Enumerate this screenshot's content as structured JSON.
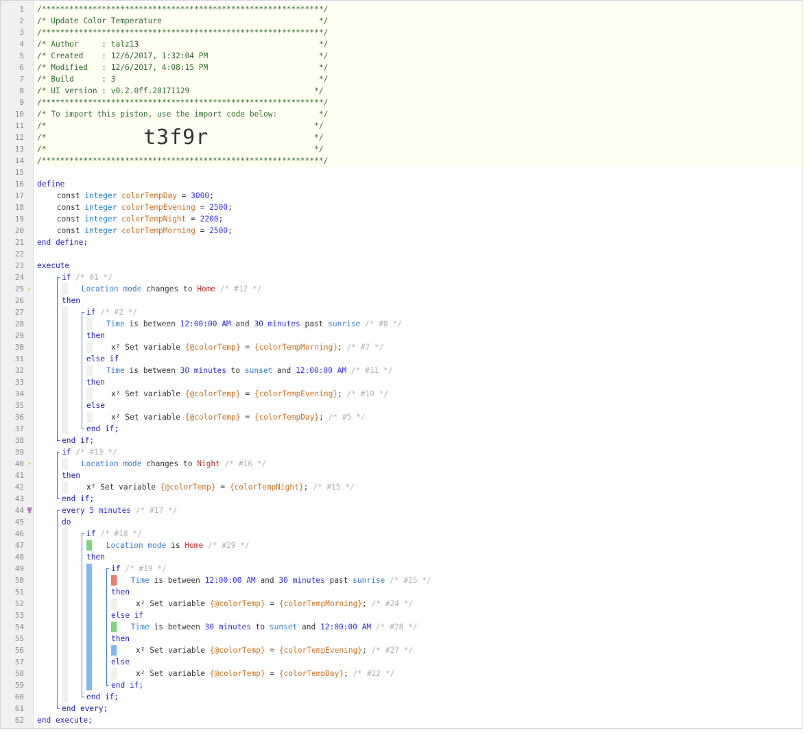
{
  "editor": {
    "lines": [
      {
        "n": "1",
        "tokens": [
          {
            "t": "/*************************************************************/",
            "c": "comment"
          }
        ]
      },
      {
        "n": "2",
        "tokens": [
          {
            "t": "/* Update Color Temperature                                  */",
            "c": "comment"
          }
        ]
      },
      {
        "n": "3",
        "tokens": [
          {
            "t": "/*************************************************************/",
            "c": "comment"
          }
        ]
      },
      {
        "n": "4",
        "tokens": [
          {
            "t": "/* Author     : talz13                                       */",
            "c": "comment"
          }
        ]
      },
      {
        "n": "5",
        "tokens": [
          {
            "t": "/* Created    : 12/6/2017, 1:32:04 PM                        */",
            "c": "comment"
          }
        ]
      },
      {
        "n": "6",
        "tokens": [
          {
            "t": "/* Modified   : 12/6/2017, 4:08:15 PM                        */",
            "c": "comment"
          }
        ]
      },
      {
        "n": "7",
        "tokens": [
          {
            "t": "/* Build      : 3                                            */",
            "c": "comment"
          }
        ]
      },
      {
        "n": "8",
        "tokens": [
          {
            "t": "/* UI version : v0.2.0ff.20171129                           */",
            "c": "comment"
          }
        ]
      },
      {
        "n": "9",
        "tokens": [
          {
            "t": "/*************************************************************/",
            "c": "comment"
          }
        ]
      },
      {
        "n": "10",
        "tokens": [
          {
            "t": "/* To import this piston, use the import code below:         */",
            "c": "comment"
          }
        ]
      },
      {
        "n": "11",
        "tokens": [
          {
            "t": "/*                                                          */",
            "c": "comment"
          }
        ]
      },
      {
        "n": "12",
        "tokens": [
          {
            "t": "/*                                                          */",
            "c": "comment"
          }
        ],
        "bigcode": "t3f9r"
      },
      {
        "n": "13",
        "tokens": [
          {
            "t": "/*                                                          */",
            "c": "comment"
          }
        ]
      },
      {
        "n": "14",
        "tokens": [
          {
            "t": "/*************************************************************/",
            "c": "comment"
          }
        ]
      },
      {
        "n": "15",
        "tokens": []
      },
      {
        "n": "16",
        "tokens": [
          {
            "t": "define",
            "c": "kw"
          }
        ]
      },
      {
        "n": "17",
        "indent": 4,
        "tokens": [
          {
            "t": "const ",
            "c": "plain"
          },
          {
            "t": "integer ",
            "c": "type"
          },
          {
            "t": "colorTempDay",
            "c": "var"
          },
          {
            "t": " = ",
            "c": "op"
          },
          {
            "t": "3000",
            "c": "num"
          },
          {
            "t": ";",
            "c": "op"
          }
        ]
      },
      {
        "n": "18",
        "indent": 4,
        "tokens": [
          {
            "t": "const ",
            "c": "plain"
          },
          {
            "t": "integer ",
            "c": "type"
          },
          {
            "t": "colorTempEvening",
            "c": "var"
          },
          {
            "t": " = ",
            "c": "op"
          },
          {
            "t": "2500",
            "c": "num"
          },
          {
            "t": ";",
            "c": "op"
          }
        ]
      },
      {
        "n": "19",
        "indent": 4,
        "tokens": [
          {
            "t": "const ",
            "c": "plain"
          },
          {
            "t": "integer ",
            "c": "type"
          },
          {
            "t": "colorTempNight",
            "c": "var"
          },
          {
            "t": " = ",
            "c": "op"
          },
          {
            "t": "2200",
            "c": "num"
          },
          {
            "t": ";",
            "c": "op"
          }
        ]
      },
      {
        "n": "20",
        "indent": 4,
        "tokens": [
          {
            "t": "const ",
            "c": "plain"
          },
          {
            "t": "integer ",
            "c": "type"
          },
          {
            "t": "colorTempMorning",
            "c": "var"
          },
          {
            "t": " = ",
            "c": "op"
          },
          {
            "t": "2500",
            "c": "num"
          },
          {
            "t": ";",
            "c": "op"
          }
        ]
      },
      {
        "n": "21",
        "tokens": [
          {
            "t": "end define;",
            "c": "kw"
          }
        ]
      },
      {
        "n": "22",
        "tokens": []
      },
      {
        "n": "23",
        "tokens": [
          {
            "t": "execute",
            "c": "kw"
          }
        ]
      },
      {
        "n": "24",
        "indent": 5,
        "tokens": [
          {
            "t": "if ",
            "c": "kw"
          },
          {
            "t": "/* #1 */",
            "c": "gray"
          }
        ]
      },
      {
        "n": "25",
        "marker": "flash",
        "indent": 9,
        "tokens": [
          {
            "t": "Location mode ",
            "c": "attr"
          },
          {
            "t": "changes to ",
            "c": "plain"
          },
          {
            "t": "Home",
            "c": "str"
          },
          {
            "t": " /* #12 */",
            "c": "gray"
          }
        ]
      },
      {
        "n": "26",
        "indent": 5,
        "tokens": [
          {
            "t": "then",
            "c": "kw"
          }
        ]
      },
      {
        "n": "27",
        "indent": 10,
        "tokens": [
          {
            "t": "if ",
            "c": "kw"
          },
          {
            "t": "/* #2 */",
            "c": "gray"
          }
        ]
      },
      {
        "n": "28",
        "indent": 14,
        "tokens": [
          {
            "t": "Time ",
            "c": "attr"
          },
          {
            "t": "is between ",
            "c": "plain"
          },
          {
            "t": "12:00:00 AM",
            "c": "num"
          },
          {
            "t": " and ",
            "c": "plain"
          },
          {
            "t": "30 minutes",
            "c": "num"
          },
          {
            "t": " past ",
            "c": "plain"
          },
          {
            "t": "sunrise",
            "c": "attr"
          },
          {
            "t": " /* #8 */",
            "c": "gray"
          }
        ]
      },
      {
        "n": "29",
        "indent": 10,
        "tokens": [
          {
            "t": "then",
            "c": "kw"
          }
        ]
      },
      {
        "n": "30",
        "indent": 15,
        "tokens": [
          {
            "t": "x² ",
            "c": "x2"
          },
          {
            "t": "Set variable ",
            "c": "plain"
          },
          {
            "t": "{@colorTemp}",
            "c": "var"
          },
          {
            "t": " = ",
            "c": "op"
          },
          {
            "t": "{colorTempMorning}",
            "c": "var"
          },
          {
            "t": ";",
            "c": "op"
          },
          {
            "t": " /* #7 */",
            "c": "gray"
          }
        ]
      },
      {
        "n": "31",
        "indent": 10,
        "tokens": [
          {
            "t": "else if",
            "c": "kw"
          }
        ]
      },
      {
        "n": "32",
        "indent": 14,
        "tokens": [
          {
            "t": "Time ",
            "c": "attr"
          },
          {
            "t": "is between ",
            "c": "plain"
          },
          {
            "t": "30 minutes",
            "c": "num"
          },
          {
            "t": " to ",
            "c": "plain"
          },
          {
            "t": "sunset",
            "c": "attr"
          },
          {
            "t": " and ",
            "c": "plain"
          },
          {
            "t": "12:00:00 AM",
            "c": "num"
          },
          {
            "t": " /* #11 */",
            "c": "gray"
          }
        ]
      },
      {
        "n": "33",
        "indent": 10,
        "tokens": [
          {
            "t": "then",
            "c": "kw"
          }
        ]
      },
      {
        "n": "34",
        "indent": 15,
        "tokens": [
          {
            "t": "x² ",
            "c": "x2"
          },
          {
            "t": "Set variable ",
            "c": "plain"
          },
          {
            "t": "{@colorTemp}",
            "c": "var"
          },
          {
            "t": " = ",
            "c": "op"
          },
          {
            "t": "{colorTempEvening}",
            "c": "var"
          },
          {
            "t": ";",
            "c": "op"
          },
          {
            "t": " /* #10 */",
            "c": "gray"
          }
        ]
      },
      {
        "n": "35",
        "indent": 10,
        "tokens": [
          {
            "t": "else",
            "c": "kw"
          }
        ]
      },
      {
        "n": "36",
        "indent": 15,
        "tokens": [
          {
            "t": "x² ",
            "c": "x2"
          },
          {
            "t": "Set variable ",
            "c": "plain"
          },
          {
            "t": "{@colorTemp}",
            "c": "var"
          },
          {
            "t": " = ",
            "c": "op"
          },
          {
            "t": "{colorTempDay}",
            "c": "var"
          },
          {
            "t": ";",
            "c": "op"
          },
          {
            "t": " /* #5 */",
            "c": "gray"
          }
        ]
      },
      {
        "n": "37",
        "indent": 10,
        "tokens": [
          {
            "t": "end if;",
            "c": "kw"
          }
        ]
      },
      {
        "n": "38",
        "indent": 5,
        "tokens": [
          {
            "t": "end if;",
            "c": "kw"
          }
        ]
      },
      {
        "n": "39",
        "indent": 5,
        "tokens": [
          {
            "t": "if ",
            "c": "kw"
          },
          {
            "t": "/* #13 */",
            "c": "gray"
          }
        ]
      },
      {
        "n": "40",
        "marker": "flash",
        "indent": 9,
        "tokens": [
          {
            "t": "Location mode ",
            "c": "attr"
          },
          {
            "t": "changes to ",
            "c": "plain"
          },
          {
            "t": "Night",
            "c": "str"
          },
          {
            "t": " /* #16 */",
            "c": "gray"
          }
        ]
      },
      {
        "n": "41",
        "indent": 5,
        "tokens": [
          {
            "t": "then",
            "c": "kw"
          }
        ]
      },
      {
        "n": "42",
        "indent": 10,
        "tokens": [
          {
            "t": "x² ",
            "c": "x2"
          },
          {
            "t": "Set variable ",
            "c": "plain"
          },
          {
            "t": "{@colorTemp}",
            "c": "var"
          },
          {
            "t": " = ",
            "c": "op"
          },
          {
            "t": "{colorTempNight}",
            "c": "var"
          },
          {
            "t": ";",
            "c": "op"
          },
          {
            "t": " /* #15 */",
            "c": "gray"
          }
        ]
      },
      {
        "n": "43",
        "indent": 5,
        "tokens": [
          {
            "t": "end if;",
            "c": "kw"
          }
        ]
      },
      {
        "n": "44",
        "marker": "every",
        "indent": 5,
        "tokens": [
          {
            "t": "every ",
            "c": "kw"
          },
          {
            "t": "5 minutes",
            "c": "num"
          },
          {
            "t": " /* #17 */",
            "c": "gray"
          }
        ]
      },
      {
        "n": "45",
        "indent": 5,
        "tokens": [
          {
            "t": "do",
            "c": "kw"
          }
        ]
      },
      {
        "n": "46",
        "indent": 10,
        "tokens": [
          {
            "t": "if ",
            "c": "kw"
          },
          {
            "t": "/* #18 */",
            "c": "gray"
          }
        ]
      },
      {
        "n": "47",
        "indent": 14,
        "tokens": [
          {
            "t": "Location mode ",
            "c": "attr"
          },
          {
            "t": "is ",
            "c": "plain"
          },
          {
            "t": "Home",
            "c": "str"
          },
          {
            "t": " /* #29 */",
            "c": "gray"
          }
        ]
      },
      {
        "n": "48",
        "indent": 10,
        "tokens": [
          {
            "t": "then",
            "c": "kw"
          }
        ]
      },
      {
        "n": "49",
        "indent": 15,
        "tokens": [
          {
            "t": "if ",
            "c": "kw"
          },
          {
            "t": "/* #19 */",
            "c": "gray"
          }
        ]
      },
      {
        "n": "50",
        "indent": 19,
        "tokens": [
          {
            "t": "Time ",
            "c": "attr"
          },
          {
            "t": "is between ",
            "c": "plain"
          },
          {
            "t": "12:00:00 AM",
            "c": "num"
          },
          {
            "t": " and ",
            "c": "plain"
          },
          {
            "t": "30 minutes",
            "c": "num"
          },
          {
            "t": " past ",
            "c": "plain"
          },
          {
            "t": "sunrise",
            "c": "attr"
          },
          {
            "t": " /* #25 */",
            "c": "gray"
          }
        ]
      },
      {
        "n": "51",
        "indent": 15,
        "tokens": [
          {
            "t": "then",
            "c": "kw"
          }
        ]
      },
      {
        "n": "52",
        "indent": 20,
        "tokens": [
          {
            "t": "x² ",
            "c": "x2"
          },
          {
            "t": "Set variable ",
            "c": "plain"
          },
          {
            "t": "{@colorTemp}",
            "c": "var"
          },
          {
            "t": " = ",
            "c": "op"
          },
          {
            "t": "{colorTempMorning}",
            "c": "var"
          },
          {
            "t": ";",
            "c": "op"
          },
          {
            "t": " /* #24 */",
            "c": "gray"
          }
        ]
      },
      {
        "n": "53",
        "indent": 15,
        "tokens": [
          {
            "t": "else if",
            "c": "kw"
          }
        ]
      },
      {
        "n": "54",
        "indent": 19,
        "tokens": [
          {
            "t": "Time ",
            "c": "attr"
          },
          {
            "t": "is between ",
            "c": "plain"
          },
          {
            "t": "30 minutes",
            "c": "num"
          },
          {
            "t": " to ",
            "c": "plain"
          },
          {
            "t": "sunset",
            "c": "attr"
          },
          {
            "t": " and ",
            "c": "plain"
          },
          {
            "t": "12:00:00 AM",
            "c": "num"
          },
          {
            "t": " /* #28 */",
            "c": "gray"
          }
        ]
      },
      {
        "n": "55",
        "indent": 15,
        "tokens": [
          {
            "t": "then",
            "c": "kw"
          }
        ]
      },
      {
        "n": "56",
        "indent": 20,
        "tokens": [
          {
            "t": "x² ",
            "c": "x2"
          },
          {
            "t": "Set variable ",
            "c": "plain"
          },
          {
            "t": "{@colorTemp}",
            "c": "var"
          },
          {
            "t": " = ",
            "c": "op"
          },
          {
            "t": "{colorTempEvening}",
            "c": "var"
          },
          {
            "t": ";",
            "c": "op"
          },
          {
            "t": " /* #27 */",
            "c": "gray"
          }
        ]
      },
      {
        "n": "57",
        "indent": 15,
        "tokens": [
          {
            "t": "else",
            "c": "kw"
          }
        ]
      },
      {
        "n": "58",
        "indent": 20,
        "tokens": [
          {
            "t": "x² ",
            "c": "x2"
          },
          {
            "t": "Set variable ",
            "c": "plain"
          },
          {
            "t": "{@colorTemp}",
            "c": "var"
          },
          {
            "t": " = ",
            "c": "op"
          },
          {
            "t": "{colorTempDay}",
            "c": "var"
          },
          {
            "t": ";",
            "c": "op"
          },
          {
            "t": " /* #22 */",
            "c": "gray"
          }
        ]
      },
      {
        "n": "59",
        "indent": 15,
        "tokens": [
          {
            "t": "end if;",
            "c": "kw"
          }
        ]
      },
      {
        "n": "60",
        "indent": 10,
        "tokens": [
          {
            "t": "end if;",
            "c": "kw"
          }
        ]
      },
      {
        "n": "61",
        "indent": 5,
        "tokens": [
          {
            "t": "end every;",
            "c": "kw"
          }
        ]
      },
      {
        "n": "62",
        "tokens": [
          {
            "t": "end execute;",
            "c": "kw"
          }
        ]
      }
    ]
  },
  "markers": {
    "flash": "⚡",
    "every": "Ψ"
  },
  "colors": {
    "banner_bg": "#fffff2",
    "comment": "#2d6a2d",
    "keyword": "#2222bb",
    "type": "#2080c8",
    "variable": "#c87020",
    "number": "#3030e0",
    "string": "#b03020",
    "status_green": "#7fd57f",
    "status_red": "#f07a6a",
    "status_blue": "#7eb9f5"
  }
}
